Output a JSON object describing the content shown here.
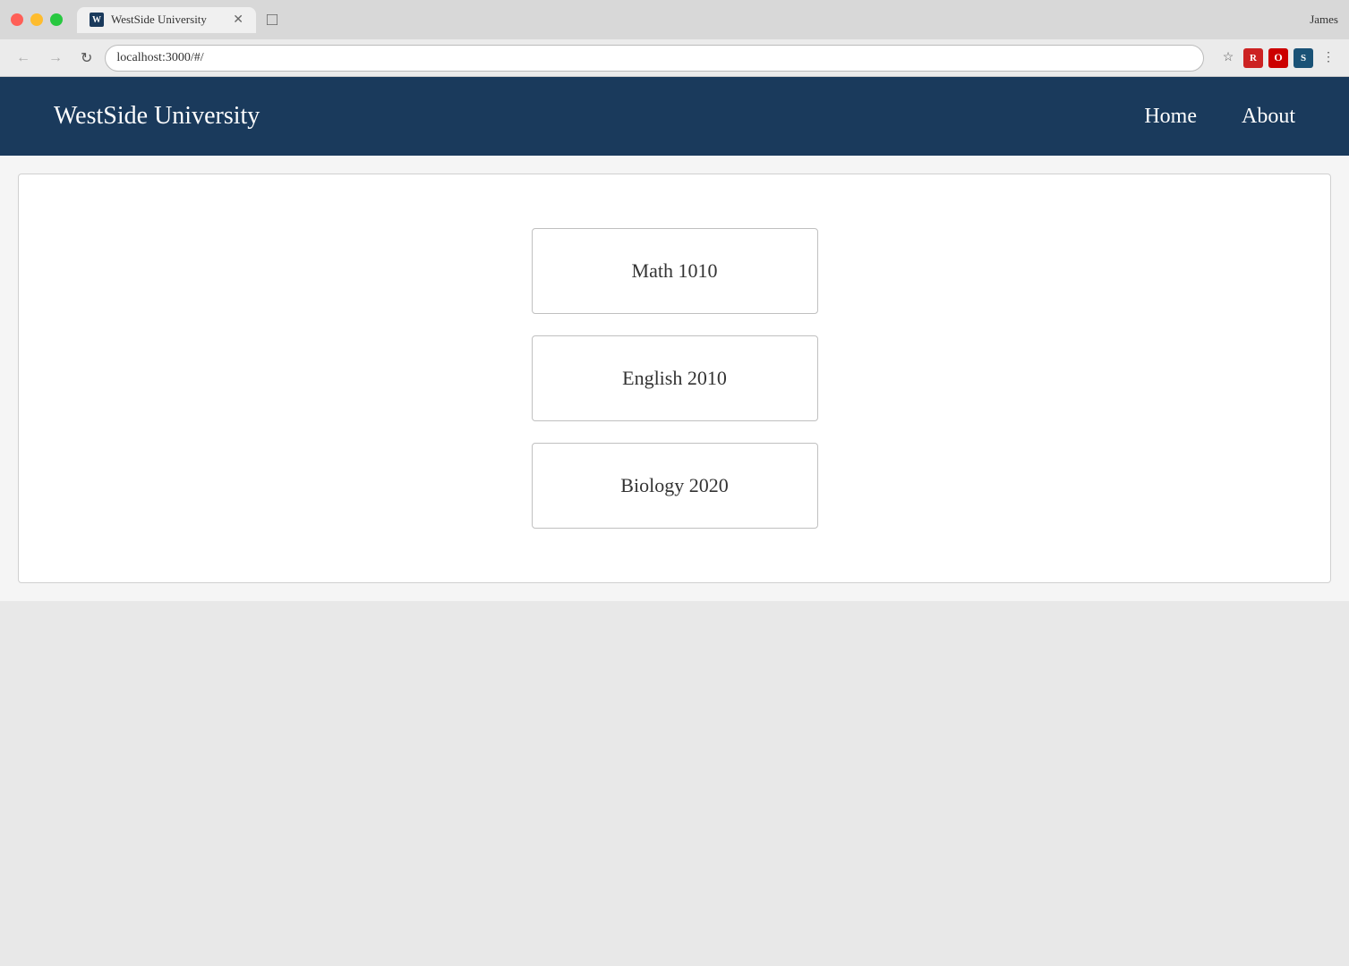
{
  "browser": {
    "tab_title": "WestSide University",
    "url": "localhost:3000/#/",
    "user_name": "James",
    "back_btn": "←",
    "forward_btn": "→",
    "reload_btn": "↻"
  },
  "navbar": {
    "logo": "WestSide University",
    "links": [
      {
        "label": "Home",
        "id": "home"
      },
      {
        "label": "About",
        "id": "about"
      }
    ]
  },
  "courses": [
    {
      "name": "Math 1010"
    },
    {
      "name": "English 2010"
    },
    {
      "name": "Biology 2020"
    }
  ]
}
